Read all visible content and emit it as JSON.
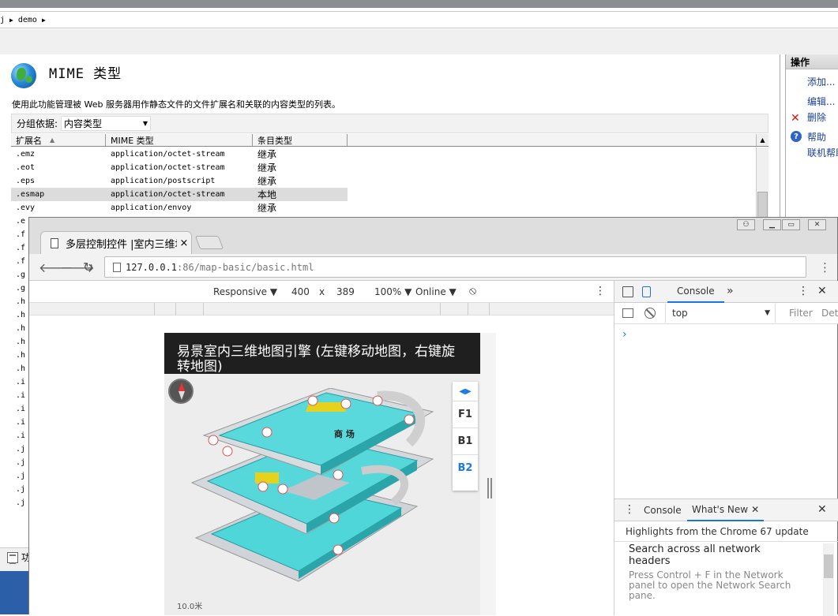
{
  "iis": {
    "breadcrumb": [
      "j",
      "demo"
    ],
    "feature_title": "MIME 类型",
    "description": "使用此功能管理被 Web 服务器用作静态文件的文件扩展名和关联的内容类型的列表。",
    "group_by_label": "分组依据:",
    "group_by_value": "内容类型",
    "columns": [
      "扩展名",
      "MIME 类型",
      "条目类型"
    ],
    "rows": [
      {
        "ext": ".emz",
        "mime": "application/octet-stream",
        "type": "继承"
      },
      {
        "ext": ".eot",
        "mime": "application/octet-stream",
        "type": "继承"
      },
      {
        "ext": ".eps",
        "mime": "application/postscript",
        "type": "继承"
      },
      {
        "ext": ".esmap",
        "mime": "application/octet-stream",
        "type": "本地",
        "selected": true
      },
      {
        "ext": ".evy",
        "mime": "application/envoy",
        "type": "继承"
      },
      {
        "ext": ".e",
        "mime": "",
        "type": ""
      },
      {
        "ext": ".f",
        "mime": "",
        "type": ""
      },
      {
        "ext": ".f",
        "mime": "",
        "type": ""
      },
      {
        "ext": ".f",
        "mime": "",
        "type": ""
      },
      {
        "ext": ".g",
        "mime": "",
        "type": ""
      },
      {
        "ext": ".g",
        "mime": "",
        "type": ""
      },
      {
        "ext": ".h",
        "mime": "",
        "type": ""
      },
      {
        "ext": ".h",
        "mime": "",
        "type": ""
      },
      {
        "ext": ".h",
        "mime": "",
        "type": ""
      },
      {
        "ext": ".h",
        "mime": "",
        "type": ""
      },
      {
        "ext": ".h",
        "mime": "",
        "type": ""
      },
      {
        "ext": ".h",
        "mime": "",
        "type": ""
      },
      {
        "ext": ".i",
        "mime": "",
        "type": ""
      },
      {
        "ext": ".i",
        "mime": "",
        "type": ""
      },
      {
        "ext": ".i",
        "mime": "",
        "type": ""
      },
      {
        "ext": ".i",
        "mime": "",
        "type": ""
      },
      {
        "ext": ".i",
        "mime": "",
        "type": ""
      },
      {
        "ext": ".j",
        "mime": "",
        "type": ""
      },
      {
        "ext": ".j",
        "mime": "",
        "type": ""
      },
      {
        "ext": ".j",
        "mime": "",
        "type": ""
      },
      {
        "ext": ".j",
        "mime": "",
        "type": ""
      },
      {
        "ext": ".j",
        "mime": "",
        "type": ""
      }
    ],
    "bottom_tab_label": "功",
    "actions_title": "操作",
    "actions": {
      "add": "添加...",
      "edit": "编辑...",
      "delete": "删除",
      "help": "帮助",
      "online_help": "联机帮助"
    }
  },
  "chrome": {
    "tab_title": "多层控制控件 |室内三维地",
    "tab_close": "×",
    "url_host": "127.0.0.1",
    "url_path": ":86/map-basic/basic.html",
    "device_toolbar": {
      "mode": "Responsive ▼",
      "width": "400",
      "x": "x",
      "height": "389",
      "zoom": "100% ▼",
      "network": "Online ▼"
    },
    "map": {
      "header_title": "易景室内三维地图引擎 (左键移动地图，右键旋转地图)",
      "floor_label_main": "商 场",
      "floors": [
        "F1",
        "B1",
        "B2"
      ],
      "active_floor": "B2",
      "scale": "10.0米"
    },
    "devtools": {
      "console_tab": "Console",
      "more": "»",
      "context": "top",
      "filter_placeholder": "Filter",
      "default_levels": "Det",
      "prompt": "›",
      "drawer": {
        "tab_console": "Console",
        "tab_whats_new": "What's New",
        "header": "Highlights from the Chrome 67 update",
        "card_title": "Search across all network headers",
        "card_desc": "Press Control + F in the Network panel to open the Network Search pane."
      }
    }
  }
}
